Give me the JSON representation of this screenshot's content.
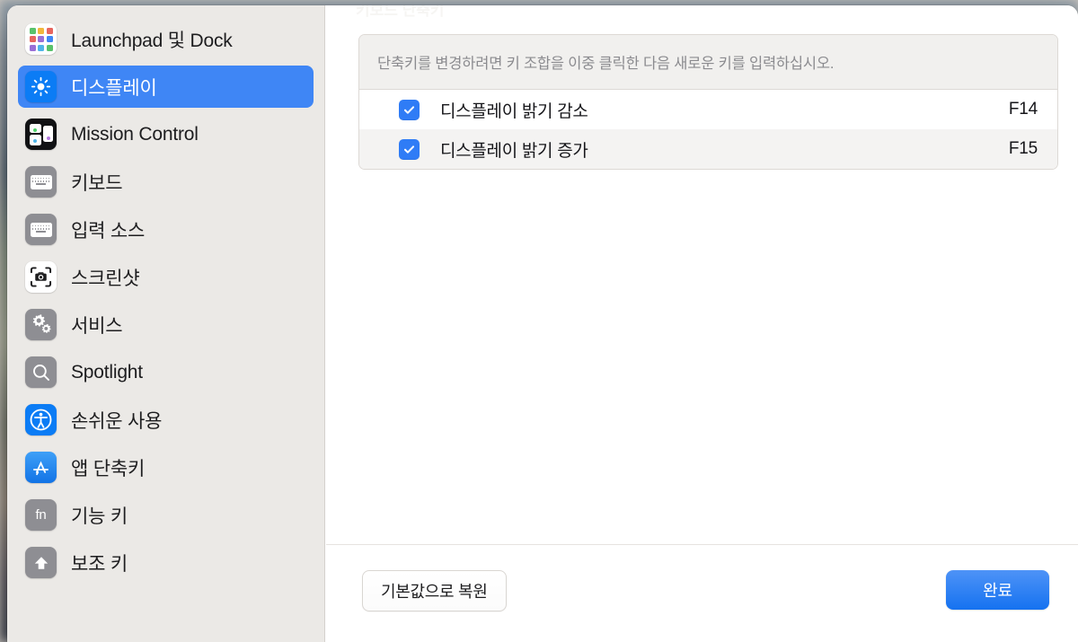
{
  "window": {
    "ghost_title": "키보드 단축키"
  },
  "sidebar": {
    "items": [
      {
        "label": "Launchpad 및 Dock",
        "icon": "launchpad-icon",
        "selected": false
      },
      {
        "label": "디스플레이",
        "icon": "brightness-icon",
        "selected": true
      },
      {
        "label": "Mission Control",
        "icon": "mission-control-icon",
        "selected": false
      },
      {
        "label": "키보드",
        "icon": "keyboard-icon",
        "selected": false
      },
      {
        "label": "입력 소스",
        "icon": "input-sources-icon",
        "selected": false
      },
      {
        "label": "스크린샷",
        "icon": "screenshot-icon",
        "selected": false
      },
      {
        "label": "서비스",
        "icon": "services-gears-icon",
        "selected": false
      },
      {
        "label": "Spotlight",
        "icon": "search-icon",
        "selected": false
      },
      {
        "label": "손쉬운 사용",
        "icon": "accessibility-icon",
        "selected": false
      },
      {
        "label": "앱 단축키",
        "icon": "app-store-icon",
        "selected": false
      },
      {
        "label": "기능 키",
        "icon": "fn-key-icon",
        "selected": false
      },
      {
        "label": "보조 키",
        "icon": "modifier-key-icon",
        "selected": false
      }
    ]
  },
  "main": {
    "hint": "단축키를 변경하려면 키 조합을 이중 클릭한 다음 새로운 키를 입력하십시오.",
    "shortcuts": [
      {
        "label": "디스플레이 밝기 감소",
        "key": "F14",
        "checked": true
      },
      {
        "label": "디스플레이 밝기 증가",
        "key": "F15",
        "checked": true
      }
    ]
  },
  "footer": {
    "restore_label": "기본값으로 복원",
    "done_label": "완료"
  },
  "colors": {
    "accent": "#3f86f5",
    "checkbox": "#2f7cf6",
    "sidebar_bg": "#ebe9e6",
    "row_alt": "#f4f3f2"
  }
}
